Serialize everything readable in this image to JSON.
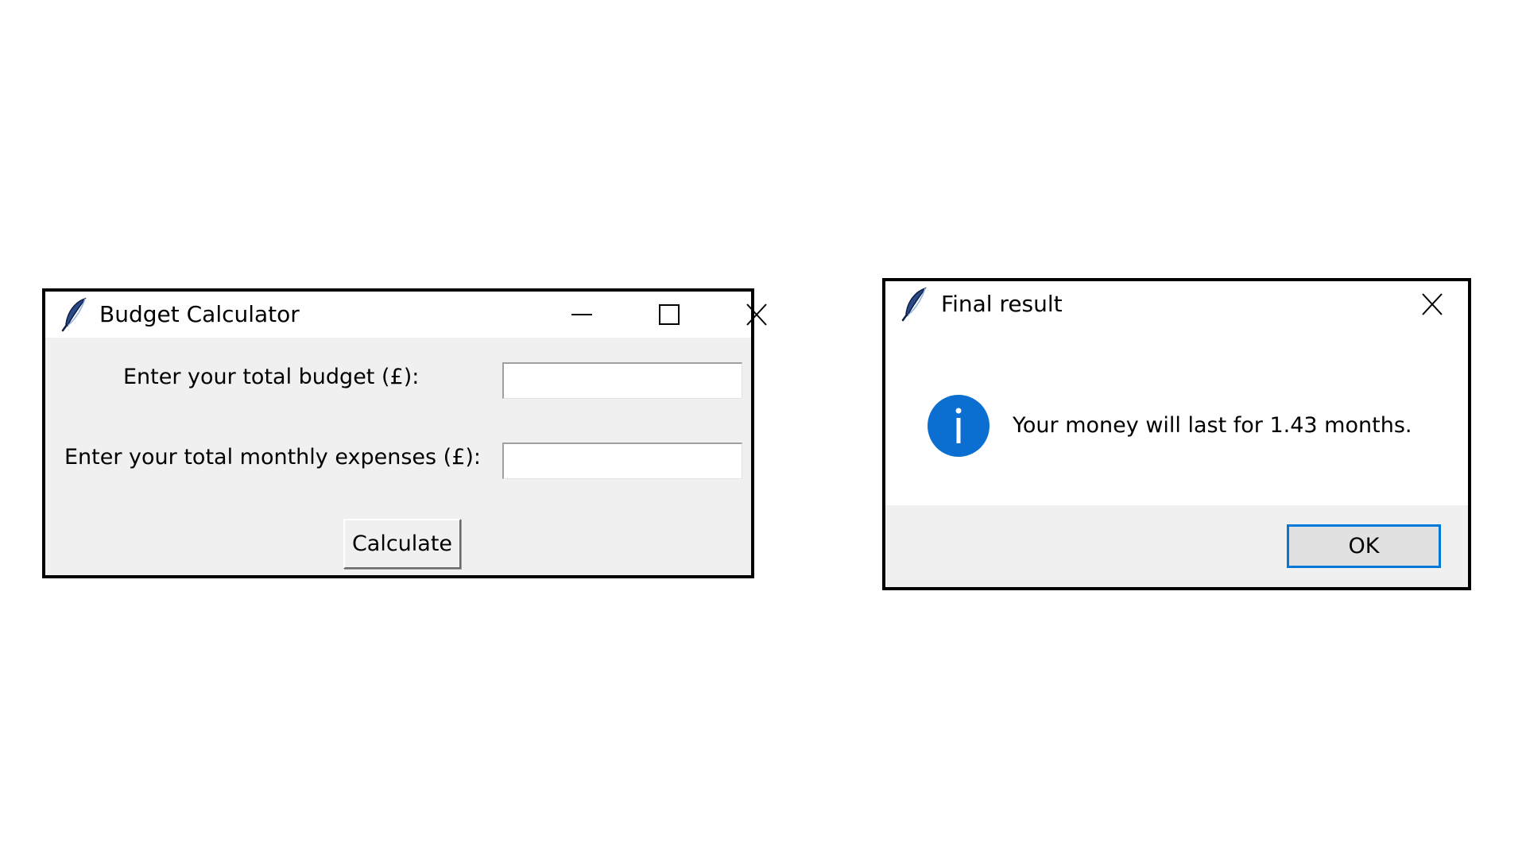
{
  "budget_window": {
    "title": "Budget Calculator",
    "icon": "feather-icon",
    "budget_label": "Enter your total budget (£):",
    "budget_value": "",
    "expenses_label": "Enter your total monthly expenses (£):",
    "expenses_value": "",
    "calculate_label": "Calculate",
    "controls": [
      "minimize-icon",
      "maximize-icon",
      "close-icon"
    ]
  },
  "result_dialog": {
    "title": "Final result",
    "icon": "feather-icon",
    "message_icon": "info-icon",
    "message": "Your money will last for 1.43 months.",
    "ok_label": "OK",
    "controls": [
      "close-icon"
    ]
  },
  "colors": {
    "window_border": "#000000",
    "client_area": "#f0f0f0",
    "titlebar": "#ffffff",
    "info_blue": "#0a6fd1",
    "focus_blue": "#0078d7"
  }
}
